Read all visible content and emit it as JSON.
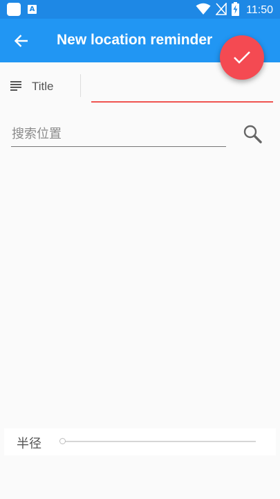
{
  "status_bar": {
    "time": "11:50",
    "notification_letter": "A",
    "icons": [
      "app-notification-icon",
      "a-notification-icon",
      "wifi-icon",
      "no-signal-icon",
      "battery-charging-icon"
    ]
  },
  "app_bar": {
    "title": "New location reminder",
    "back_icon": "arrow-back-icon",
    "color": "#2196f3"
  },
  "fab": {
    "icon": "check-icon",
    "color": "#f44a52"
  },
  "title_field": {
    "label": "Title",
    "value": "",
    "underline_color": "#ef5350"
  },
  "search": {
    "placeholder": "搜索位置",
    "value": "",
    "icon": "search-icon"
  },
  "radius": {
    "label": "半径",
    "value_fraction": 0
  }
}
